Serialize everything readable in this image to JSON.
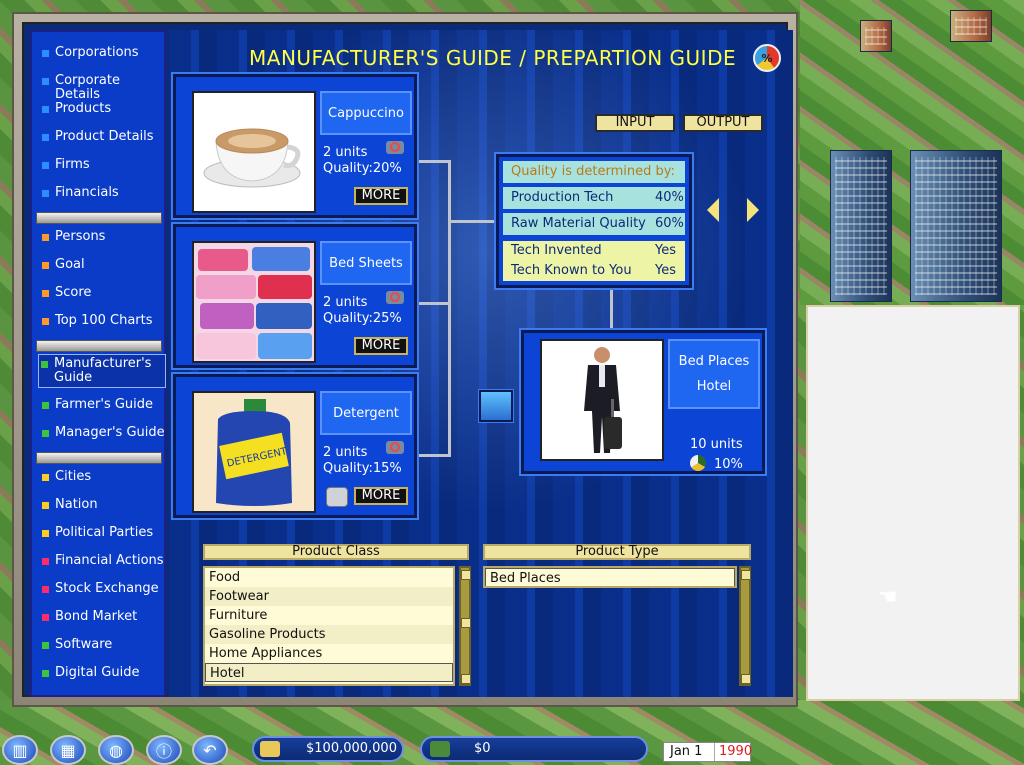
{
  "title": "MANUFACTURER'S GUIDE / PREPARTION GUIDE",
  "sidebar": {
    "items": [
      {
        "label": "Corporations",
        "color": "#2f8cff"
      },
      {
        "label": "Corporate Details",
        "color": "#2f8cff"
      },
      {
        "label": "Products",
        "color": "#2f8cff"
      },
      {
        "label": "Product Details",
        "color": "#2f8cff"
      },
      {
        "label": "Firms",
        "color": "#2f8cff"
      },
      {
        "label": "Financials",
        "color": "#2f8cff"
      },
      {
        "label": "Persons",
        "color": "#ff9a2a"
      },
      {
        "label": "Goal",
        "color": "#ff9a2a"
      },
      {
        "label": "Score",
        "color": "#ff9a2a"
      },
      {
        "label": "Top 100 Charts",
        "color": "#ff9a2a"
      },
      {
        "label": "Manufacturer's Guide",
        "color": "#3cc43c"
      },
      {
        "label": "Farmer's Guide",
        "color": "#3cc43c"
      },
      {
        "label": "Manager's Guide",
        "color": "#3cc43c"
      },
      {
        "label": "Cities",
        "color": "#ffcc22"
      },
      {
        "label": "Nation",
        "color": "#ffcc22"
      },
      {
        "label": "Political Parties",
        "color": "#ffcc22"
      },
      {
        "label": "Financial Actions",
        "color": "#ff2a6a"
      },
      {
        "label": "Stock Exchange",
        "color": "#ff2a6a"
      },
      {
        "label": "Bond Market",
        "color": "#ff2a6a"
      },
      {
        "label": "Software",
        "color": "#3cc43c"
      },
      {
        "label": "Digital Guide",
        "color": "#3cc43c"
      }
    ]
  },
  "inputs": [
    {
      "name": "Cappuccino",
      "units": "2 units",
      "quality": "Quality:20%",
      "more": "MORE"
    },
    {
      "name": "Bed Sheets",
      "units": "2 units",
      "quality": "Quality:25%",
      "more": "MORE"
    },
    {
      "name": "Detergent",
      "units": "2 units",
      "quality": "Quality:15%",
      "more": "MORE"
    }
  ],
  "toggles": {
    "input": "INPUT",
    "output": "OUTPUT"
  },
  "quality": {
    "header": "Quality is determined by:",
    "rows": [
      {
        "label": "Production Tech",
        "value": "40%"
      },
      {
        "label": "Raw Material Quality",
        "value": "60%"
      },
      {
        "label": "Tech Invented",
        "value": "Yes"
      },
      {
        "label": "Tech Known to You",
        "value": "Yes"
      }
    ]
  },
  "output": {
    "name1": "Bed Places",
    "name2": "Hotel",
    "units": "10 units",
    "pct": "10%"
  },
  "product_class": {
    "header": "Product Class",
    "items": [
      "Food",
      "Footwear",
      "Furniture",
      "Gasoline Products",
      "Home Appliances",
      "Hotel"
    ]
  },
  "product_type": {
    "header": "Product Type",
    "items": [
      "Bed Places"
    ]
  },
  "bottom": {
    "cash": "$100,000,000",
    "profit": "$0",
    "date": "Jan 1",
    "year": "1990"
  },
  "pie_label": "%"
}
